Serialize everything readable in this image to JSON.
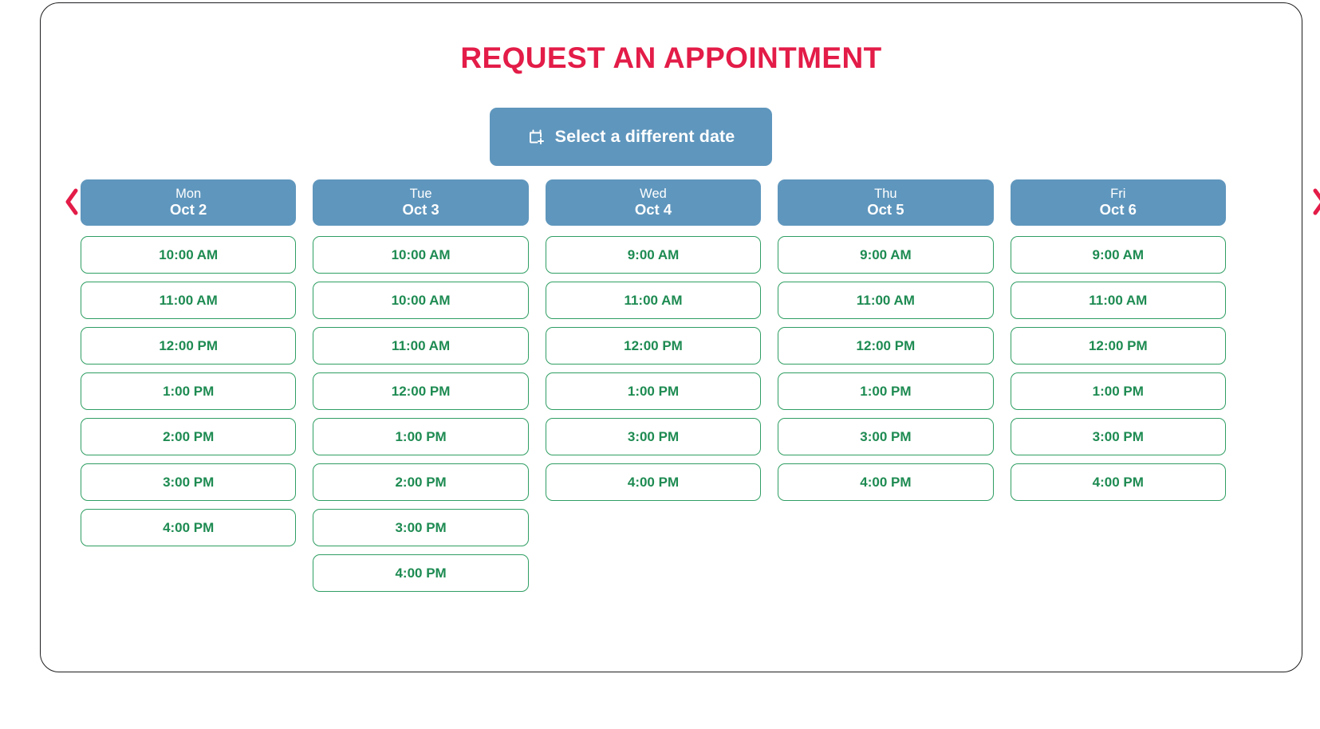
{
  "theme": {
    "title_color": "#e31c48",
    "header_blue": "#5f96bd",
    "slot_green": "#1e8b52",
    "slot_border_green": "#2f9e63",
    "arrow_red": "#e31c48",
    "card_border": "#1d1d1f",
    "page_background": "#ffffff"
  },
  "header": {
    "title": "REQUEST AN APPOINTMENT"
  },
  "toolbar": {
    "select_date_label": "Select a different date",
    "select_date_icon": "calendar-plus-icon"
  },
  "navigation": {
    "prev_label": "‹",
    "prev_icon": "chevron-left-icon",
    "next_label": "›",
    "next_icon": "chevron-right-icon"
  },
  "week": {
    "days": [
      {
        "dow": "Mon",
        "date": "Oct 2",
        "slots": [
          "10:00 AM",
          "11:00 AM",
          "12:00 PM",
          "1:00 PM",
          "2:00 PM",
          "3:00 PM",
          "4:00 PM"
        ]
      },
      {
        "dow": "Tue",
        "date": "Oct 3",
        "slots": [
          "10:00 AM",
          "10:00 AM",
          "11:00 AM",
          "12:00 PM",
          "1:00 PM",
          "2:00 PM",
          "3:00 PM",
          "4:00 PM"
        ]
      },
      {
        "dow": "Wed",
        "date": "Oct 4",
        "slots": [
          "9:00 AM",
          "11:00 AM",
          "12:00 PM",
          "1:00 PM",
          "3:00 PM",
          "4:00 PM"
        ]
      },
      {
        "dow": "Thu",
        "date": "Oct 5",
        "slots": [
          "9:00 AM",
          "11:00 AM",
          "12:00 PM",
          "1:00 PM",
          "3:00 PM",
          "4:00 PM"
        ]
      },
      {
        "dow": "Fri",
        "date": "Oct 6",
        "slots": [
          "9:00 AM",
          "11:00 AM",
          "12:00 PM",
          "1:00 PM",
          "3:00 PM",
          "4:00 PM"
        ]
      }
    ]
  }
}
